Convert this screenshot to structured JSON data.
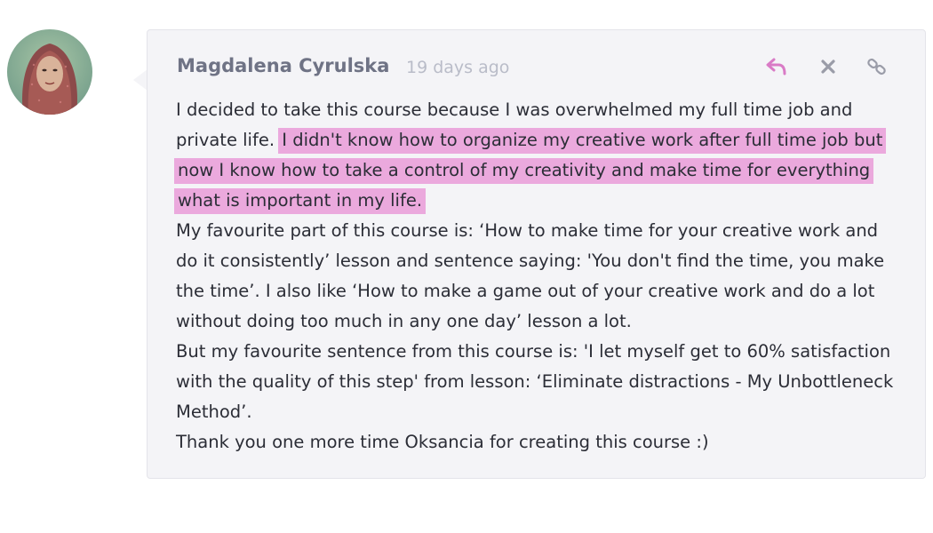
{
  "comment": {
    "author": "Magdalena Cyrulska",
    "timestamp": "19 days ago",
    "actions": {
      "reply_icon": "reply-icon",
      "close_icon": "close-icon",
      "link_icon": "link-icon"
    },
    "body": {
      "intro": "I decided to take this course because I was overwhelmed my full time job and private life.",
      "highlight": "I didn't know how to organize my creative work after full time job but now I know how to take a control of my creativity and make time for everything what is important in my life.",
      "paragraph_2": "My favourite part of this course is: ‘How to make time for your creative work and do it consistently’ lesson and sentence saying: 'You don't find the time, you make the time’. I also like ‘How to make a game out of your creative work and do a lot without doing too much in any one day’ lesson a lot.",
      "paragraph_3": "But my favourite sentence from this course is: 'I let myself get to 60% satisfaction with the quality of this step' from lesson: ‘Eliminate distractions - My Unbottleneck Method’.",
      "paragraph_4": "Thank you one more time Oksancia for creating this course :)"
    }
  },
  "colors": {
    "highlight": "#eba9dd",
    "reply_icon": "#d97bc6",
    "muted_icon": "#9a9ca8",
    "card_bg": "#f4f4f7"
  }
}
